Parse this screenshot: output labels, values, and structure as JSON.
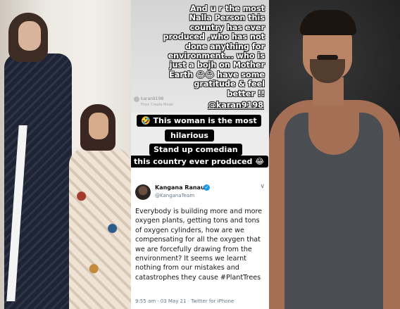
{
  "story": {
    "text": "And u r the most\nNalla   Person this\ncountry has ever\nproduced ,who has not\ndone anything for\nenvironment... who is\njust a bojh on Mother\nEarth 😂😂 have some\ngratitude & feel\nbetter !!",
    "mention": "@karan9198",
    "username": "karan9198",
    "subline": "From Create Mode"
  },
  "captions": {
    "line1": "🤣 This woman is the most",
    "line2": "hilarious",
    "line3": "Stand up comedian",
    "line4": "this country ever produced 😂"
  },
  "tweet": {
    "name": "Kangana Ranaut",
    "verified_icon": "✓",
    "handle": "@KanganaTeam",
    "menu_icon": "∨",
    "body": "Everybody is building more and more oxygen plants, getting tons and tons of oxygen cylinders, how are we compensating for all the oxygen that we are forcefully drawing from the environment? It seems we learnt nothing from our mistakes and catastrophes they cause #PlantTrees",
    "meta": "9:55 am · 03 May 21 · Twitter for iPhone"
  }
}
